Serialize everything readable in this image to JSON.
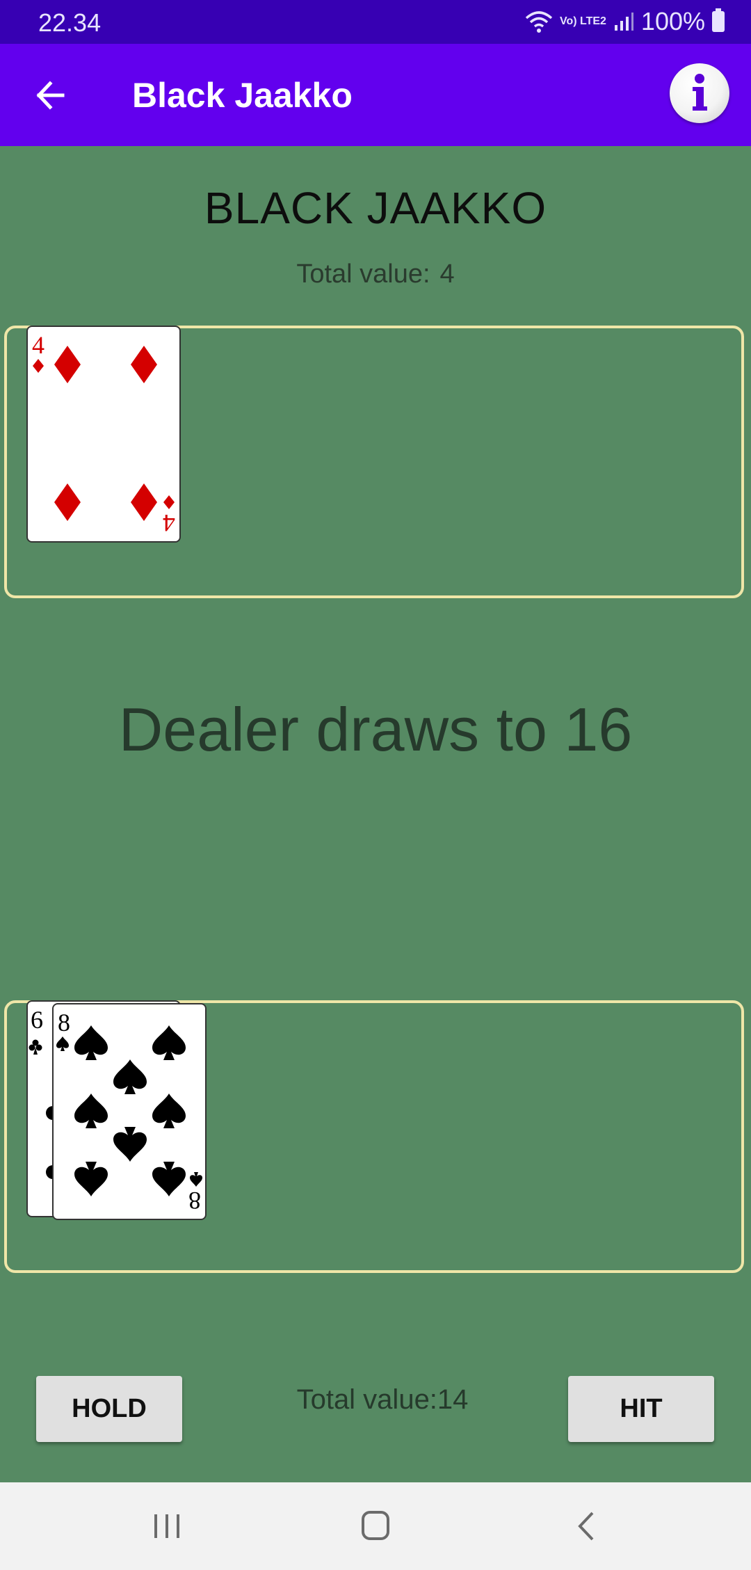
{
  "status_bar": {
    "time": "22.34",
    "network": "Vo) LTE2",
    "battery": "100%"
  },
  "app_bar": {
    "title": "Black Jaakko",
    "back_icon": "arrow-left-icon",
    "info_icon": "info-icon"
  },
  "game": {
    "heading": "BLACK JAAKKO",
    "dealer_total_label": "Total value:",
    "dealer_total_value": "4",
    "rule_text": "Dealer draws to 16",
    "player_total_text": "Total value:14"
  },
  "dealer_hand": [
    {
      "rank": "4",
      "suit": "diamonds"
    }
  ],
  "player_hand": [
    {
      "rank": "6",
      "suit": "clubs"
    },
    {
      "rank": "8",
      "suit": "spades"
    }
  ],
  "buttons": {
    "hold": "HOLD",
    "hit": "HIT"
  },
  "colors": {
    "felt": "#568a63",
    "app_bar": "#6200ee",
    "status_bar": "#3700b3",
    "hand_border": "#efe6a8",
    "red_suit": "#d40000"
  }
}
